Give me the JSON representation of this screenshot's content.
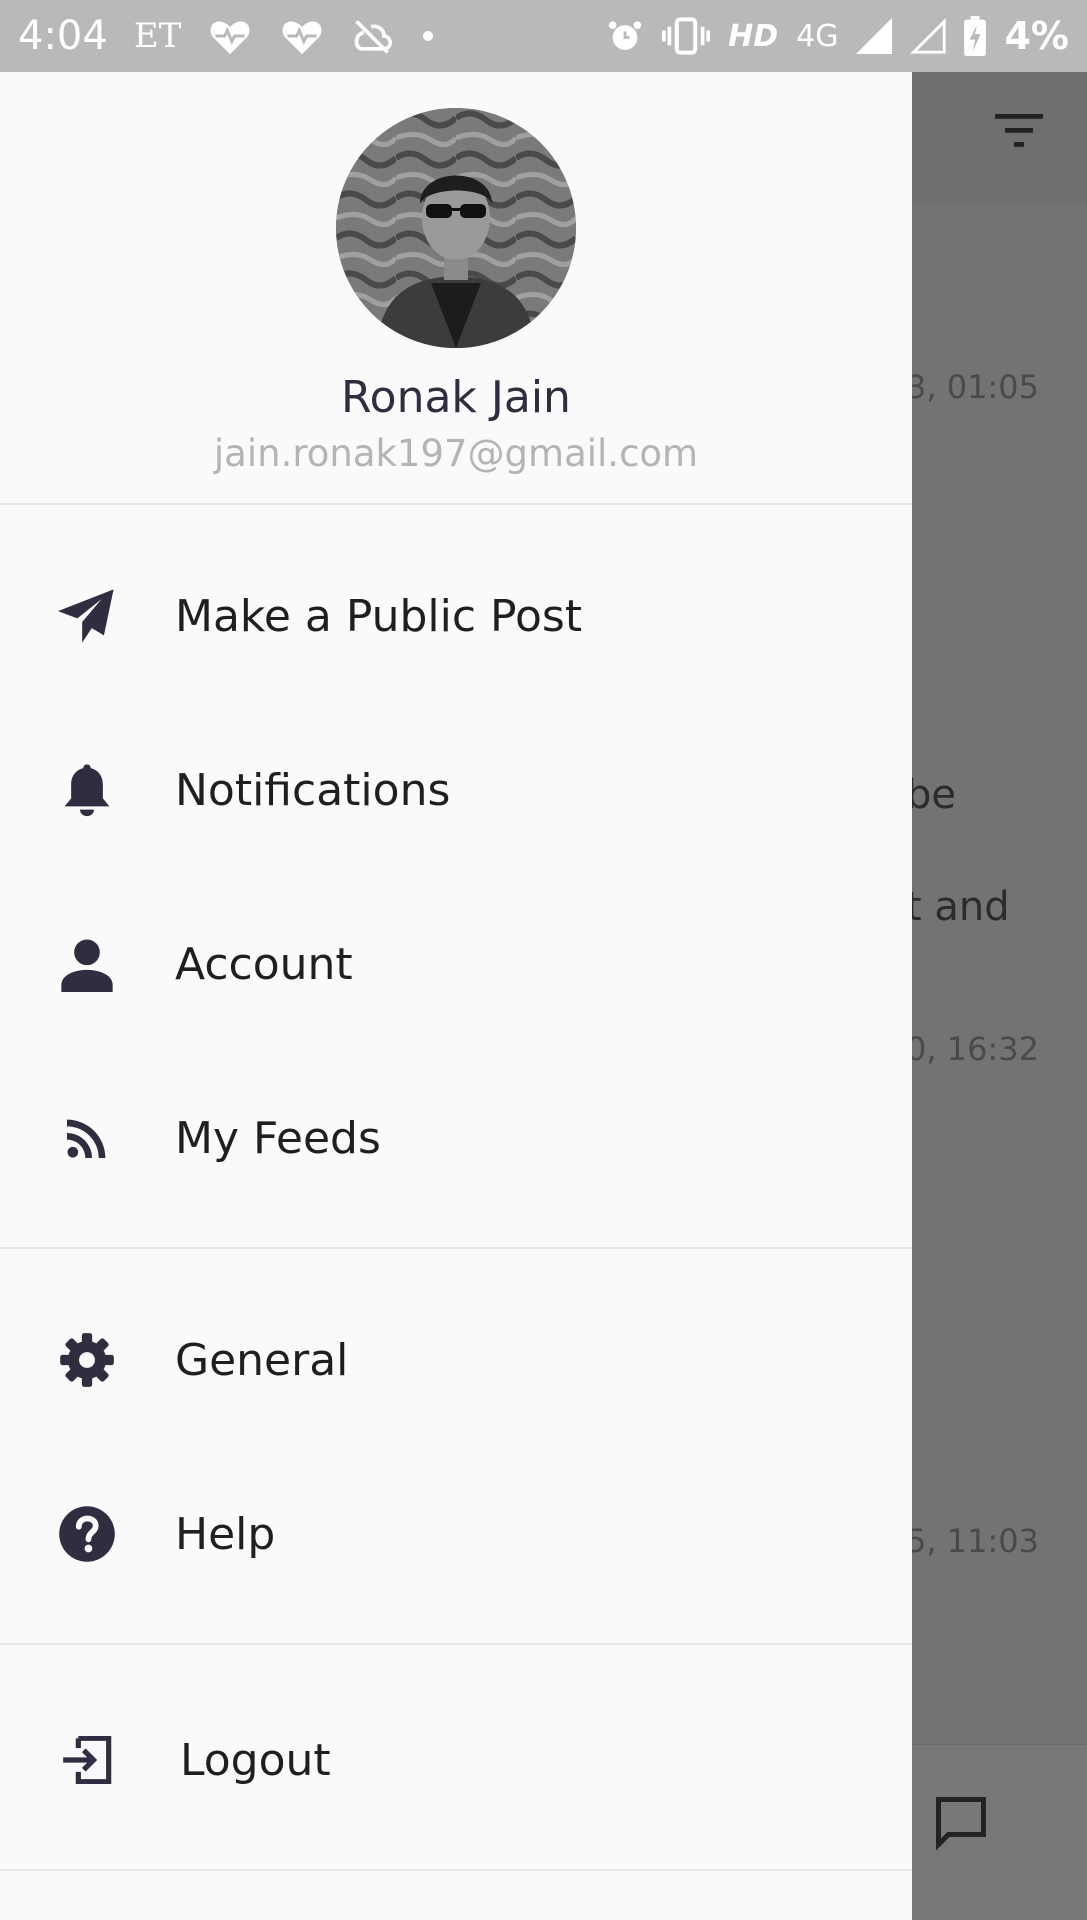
{
  "status_bar": {
    "time": "4:04",
    "carrier_tag": "ET",
    "network_hd": "HD",
    "network_type": "4G",
    "battery": "4%"
  },
  "background": {
    "rows": [
      {
        "time": "3, 01:05"
      },
      {
        "text_line1": "be",
        "text_line2": "t and",
        "time": "0, 16:32"
      },
      {
        "time": "5, 11:03"
      }
    ]
  },
  "profile": {
    "name": "Ronak Jain",
    "email": "jain.ronak197@gmail.com"
  },
  "menu": {
    "section1": [
      {
        "label": "Make a Public Post",
        "icon": "paper-plane-icon"
      },
      {
        "label": "Notifications",
        "icon": "bell-icon"
      },
      {
        "label": "Account",
        "icon": "person-icon"
      },
      {
        "label": "My Feeds",
        "icon": "rss-icon"
      }
    ],
    "section2": [
      {
        "label": "General",
        "icon": "gear-icon"
      },
      {
        "label": "Help",
        "icon": "help-circle-icon"
      }
    ],
    "section3": [
      {
        "label": "Logout",
        "icon": "logout-icon"
      }
    ]
  },
  "colors": {
    "drawer_bg": "#fafafa",
    "icon": "#2f2e41",
    "email": "#b4b4b4",
    "scrim": "#737373"
  }
}
